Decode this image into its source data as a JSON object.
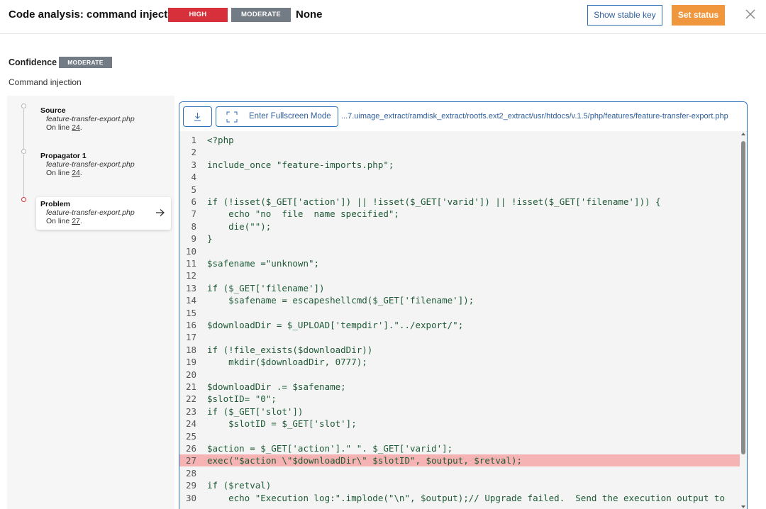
{
  "header": {
    "title": "Code analysis: command injection",
    "severity_high": "HIGH",
    "severity_moderate": "MODERATE",
    "severity_none": "None",
    "show_key_label": "Show stable key",
    "set_status_label": "Set status",
    "close_icon": "close-icon"
  },
  "confidence": {
    "label": "Confidence",
    "badge": "MODERATE"
  },
  "subtitle": "Command injection",
  "steps": [
    {
      "title": "Source",
      "file": "feature-transfer-export.php",
      "line_prefix": "On line ",
      "line": "24",
      "line_suffix": "."
    },
    {
      "title": "Propagator 1",
      "file": "feature-transfer-export.php",
      "line_prefix": "On line ",
      "line": "24",
      "line_suffix": "."
    },
    {
      "title": "Problem",
      "file": "feature-transfer-export.php",
      "line_prefix": "On line ",
      "line": "27",
      "line_suffix": "."
    }
  ],
  "code_view": {
    "download_icon": "download-icon",
    "fullscreen_label": "Enter Fullscreen Mode",
    "fullscreen_icon": "fullscreen-icon",
    "path": "...7.uimage_extract/ramdisk_extract/rootfs.ext2_extract/usr/htdocs/v.1.5/php/features/feature-transfer-export.php",
    "highlighted_line": 27,
    "lines": [
      "<?php",
      "",
      "include_once \"feature-imports.php\";",
      "",
      "",
      "if (!isset($_GET['action']) || !isset($_GET['varid']) || !isset($_GET['filename'])) {",
      "    echo \"no  file  name specified\";",
      "    die(\"\");",
      "}",
      "",
      "$safename =\"unknown\";",
      "",
      "if ($_GET['filename'])",
      "    $safename = escapeshellcmd($_GET['filename']);",
      "",
      "$downloadDir = $_UPLOAD['tempdir'].\"../export/\";",
      "",
      "if (!file_exists($downloadDir))",
      "    mkdir($downloadDir, 0777);",
      "",
      "$downloadDir .= $safename;",
      "$slotID= \"0\";",
      "if ($_GET['slot'])",
      "    $slotID = $_GET['slot'];",
      "",
      "$action = $_GET['action'].\" \". $_GET['varid'];",
      "exec(\"$action \\\"$downloadDir\\\" $slotID\", $output, $retval);",
      "",
      "if ($retval)",
      "    echo \"Execution log:\".implode(\"\\n\", $output);// Upgrade failed.  Send the execution output to"
    ]
  }
}
